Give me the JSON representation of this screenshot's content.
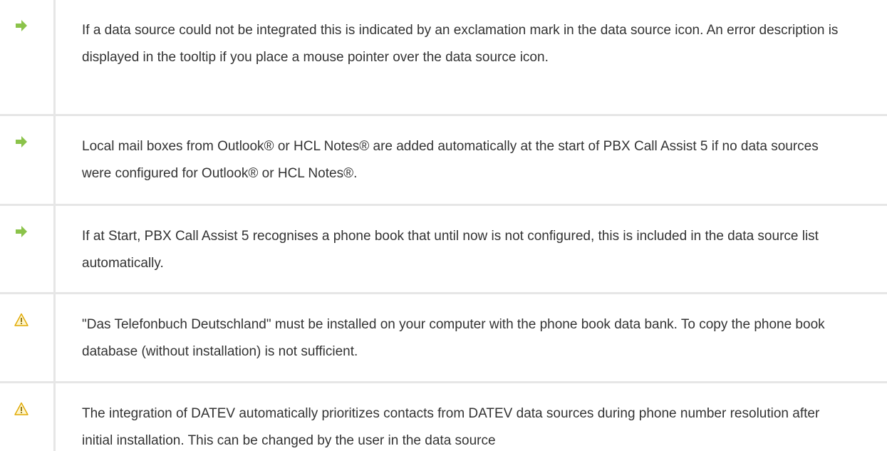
{
  "colors": {
    "arrow_green": "#8bc34a",
    "warning_yellow": "#f5c518",
    "divider": "#e6e6e6",
    "text": "#333333"
  },
  "notes": [
    {
      "icon": "arrow-right-icon",
      "text": "If a data source could not be integrated this is indicated by an exclamation mark in the data source icon. An error description is displayed in the tooltip if you place a mouse pointer over the data source icon."
    },
    {
      "icon": "arrow-right-icon",
      "text": "Local mail boxes from Outlook® or HCL Notes® are added automatically at the start of PBX Call Assist 5 if no data sources were configured for Outlook® or HCL Notes®."
    },
    {
      "icon": "arrow-right-icon",
      "text": "If at Start, PBX Call Assist 5 recognises a phone book that until now is not configured, this is included in the data source list automatically."
    },
    {
      "icon": "warning-icon",
      "text": "\"Das Telefonbuch Deutschland\" must be installed on your computer with the phone book data bank. To copy the phone book database (without installation) is not sufficient."
    },
    {
      "icon": "warning-icon",
      "text": "The integration of DATEV automatically prioritizes contacts from DATEV data sources during phone number resolution after initial installation. This can be changed by the user in the data source"
    }
  ]
}
